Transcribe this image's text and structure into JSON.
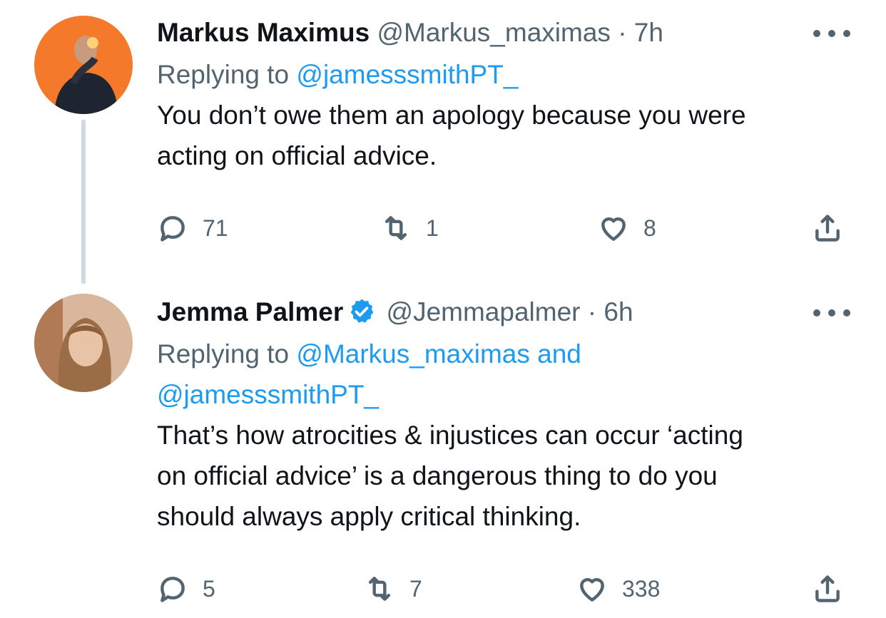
{
  "tweets": [
    {
      "name": "Markus Maximus",
      "handle": "@Markus_maximas",
      "time": "· 7h",
      "replying_prefix": "Replying to ",
      "replying_mentions": "@jamesssmithPT_",
      "replying_mentions_line2": "",
      "text_lines": [
        "You don’t owe them an apology because you were",
        "acting on official advice."
      ],
      "replies": "71",
      "retweets": "1",
      "likes": "8",
      "verified": false
    },
    {
      "name": "Jemma Palmer",
      "handle": "@Jemmapalmer",
      "time": "· 6h",
      "replying_prefix": "Replying to ",
      "replying_mentions": "@Markus_maximas and",
      "replying_mentions_line2": "@jamesssmithPT_",
      "text_lines": [
        "That’s how atrocities & injustices can occur ‘acting",
        "on official advice’ is a dangerous thing to do you",
        "should always apply critical thinking."
      ],
      "replies": "5",
      "retweets": "7",
      "likes": "338",
      "verified": true
    }
  ],
  "colors": {
    "text": "#0f1419",
    "secondary": "#536471",
    "link": "#1d9bf0",
    "thread_line": "#cfd9de",
    "verified": "#1d9bf0"
  },
  "icons": [
    "reply-icon",
    "retweet-icon",
    "like-icon",
    "share-icon",
    "more-icon",
    "verified-badge-icon"
  ]
}
